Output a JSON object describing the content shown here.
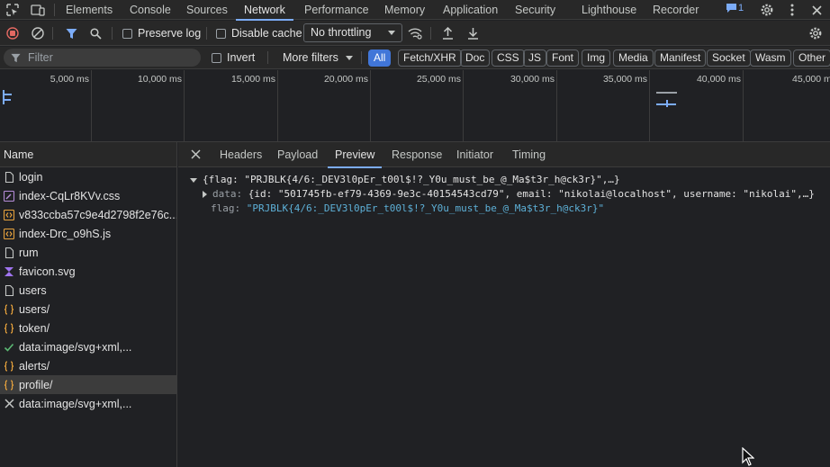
{
  "top_tabs": [
    "Elements",
    "Console",
    "Sources",
    "Network",
    "Performance",
    "Memory",
    "Application",
    "Security",
    "Lighthouse",
    "Recorder"
  ],
  "active_top_tab": "Network",
  "issues_count": "1",
  "toolbar": {
    "preserve_log": "Preserve log",
    "disable_cache": "Disable cache",
    "throttling": "No throttling"
  },
  "filter": {
    "placeholder": "Filter",
    "invert": "Invert",
    "more_filters": "More filters",
    "types": [
      "All",
      "Fetch/XHR",
      "Doc",
      "CSS",
      "JS",
      "Font",
      "Img",
      "Media",
      "Manifest",
      "Socket",
      "Wasm",
      "Other"
    ]
  },
  "timeline": {
    "labels": [
      "5,000 ms",
      "10,000 ms",
      "15,000 ms",
      "20,000 ms",
      "25,000 ms",
      "30,000 ms",
      "35,000 ms",
      "40,000 ms",
      "45,000 m"
    ]
  },
  "requests": {
    "header": "Name",
    "items": [
      {
        "name": "login",
        "icon": "document-icon"
      },
      {
        "name": "index-CqLr8KVv.css",
        "icon": "stylesheet-icon"
      },
      {
        "name": "v833ccba57c9e4d2798f2e76c...",
        "icon": "script-icon"
      },
      {
        "name": "index-Drc_o9hS.js",
        "icon": "script-icon"
      },
      {
        "name": "rum",
        "icon": "document-icon"
      },
      {
        "name": "favicon.svg",
        "icon": "image-icon"
      },
      {
        "name": "users",
        "icon": "document-icon"
      },
      {
        "name": "users/",
        "icon": "fetch-icon"
      },
      {
        "name": "token/",
        "icon": "fetch-icon"
      },
      {
        "name": "data:image/svg+xml,...",
        "icon": "check-icon"
      },
      {
        "name": "alerts/",
        "icon": "fetch-icon"
      },
      {
        "name": "profile/",
        "icon": "fetch-icon",
        "selected": true
      },
      {
        "name": "data:image/svg+xml,...",
        "icon": "cross-icon"
      }
    ]
  },
  "detail_tabs": [
    "Headers",
    "Payload",
    "Preview",
    "Response",
    "Initiator",
    "Timing"
  ],
  "active_detail_tab": "Preview",
  "preview": {
    "root": "{flag: \"PRJBLK{4/6:_DEV3l0pEr_t00l$!?_Y0u_must_be_@_Ma$t3r_h@ck3r}\",…}",
    "data_key": "data",
    "data_value": "{id: \"501745fb-ef79-4369-9e3c-40154543cd79\", email: \"nikolai@localhost\", username: \"nikolai\",…}",
    "flag_key": "flag",
    "flag_value": "\"PRJBLK{4/6:_DEV3l0pEr_t00l$!?_Y0u_must_be_@_Ma$t3r_h@ck3r}\""
  },
  "colors": {
    "accent": "#7cacf8",
    "record": "#e46962",
    "string": "#5db0d7"
  }
}
